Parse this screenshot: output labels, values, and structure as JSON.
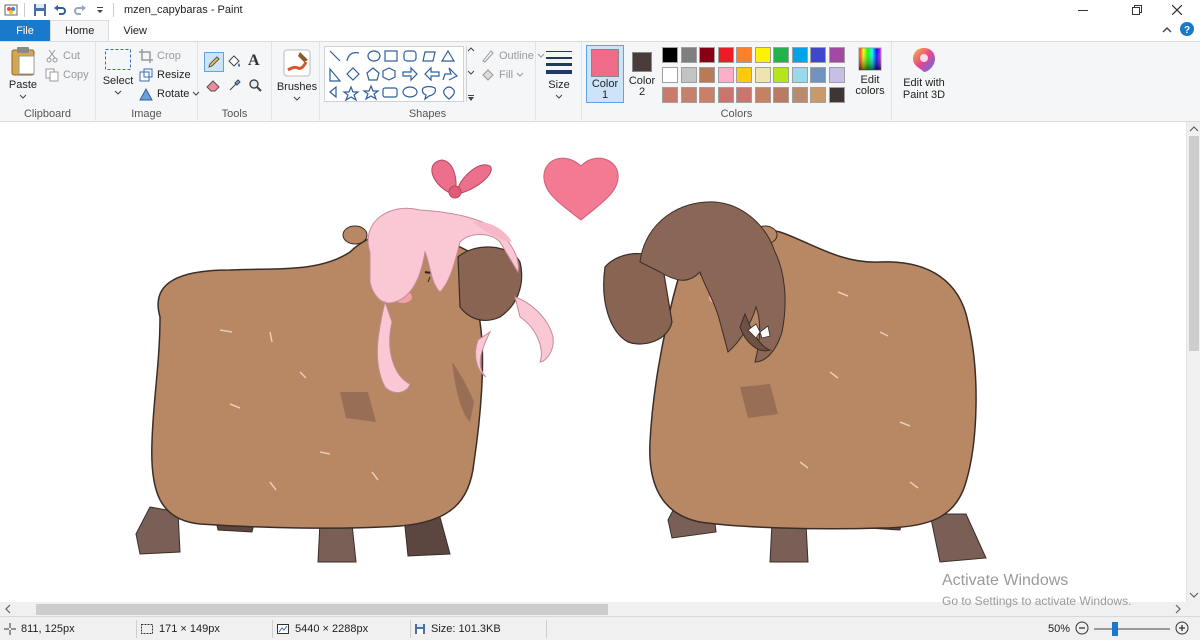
{
  "window": {
    "title": "mzen_capybaras - Paint"
  },
  "tabs": [
    {
      "label": "File"
    },
    {
      "label": "Home"
    },
    {
      "label": "View"
    }
  ],
  "ribbon": {
    "clipboard": {
      "label": "Clipboard",
      "paste": "Paste",
      "cut": "Cut",
      "copy": "Copy"
    },
    "image": {
      "label": "Image",
      "select": "Select",
      "crop": "Crop",
      "resize": "Resize",
      "rotate": "Rotate"
    },
    "tools": {
      "label": "Tools"
    },
    "brushes": {
      "label": "Brushes"
    },
    "shapes": {
      "label": "Shapes",
      "outline": "Outline",
      "fill": "Fill"
    },
    "size": {
      "label": "Size"
    },
    "colors": {
      "label": "Colors",
      "color1_line1": "Color",
      "color1_line2": "1",
      "color2_line1": "Color",
      "color2_line2": "2",
      "edit_colors_line1": "Edit",
      "edit_colors_line2": "colors",
      "color1": "#f06b8a",
      "color2": "#4a3c3a",
      "palette_row1": [
        "#000000",
        "#7f7f7f",
        "#880015",
        "#ed1c24",
        "#ff7f27",
        "#fff200",
        "#22b14c",
        "#00a2e8",
        "#3f48cc",
        "#a349a4"
      ],
      "palette_row2": [
        "#ffffff",
        "#c3c3c3",
        "#b97a57",
        "#ffaec9",
        "#ffc90e",
        "#efe4b0",
        "#b5e61d",
        "#99d9ea",
        "#7092be",
        "#c8bfe7"
      ],
      "palette_row3": [
        "#c97a6a",
        "#c4816e",
        "#c98068",
        "#c7766e",
        "#c8776f",
        "#c58163",
        "#b97c63",
        "#b98a6e",
        "#c8996a",
        "#3e3634"
      ]
    },
    "paint3d": {
      "line1": "Edit with",
      "line2": "Paint 3D"
    }
  },
  "status": {
    "cursor": "811, 125px",
    "selection": "171 × 149px",
    "dimensions": "5440 × 2288px",
    "size": "Size: 101.3KB",
    "zoom": "50%",
    "zoom_level": 0.5
  },
  "watermark": {
    "title": "Activate Windows",
    "subtitle": "Go to Settings to activate Windows."
  },
  "colors": {
    "accent": "#1979ca",
    "fur": "#b78863",
    "fur_dark": "#8a6452",
    "legs": "#7a5f56",
    "pink_hair": "#f9c8d4",
    "brown_hair": "#8a6656",
    "bow": "#ec6f8e",
    "heart": "#f37a93"
  }
}
